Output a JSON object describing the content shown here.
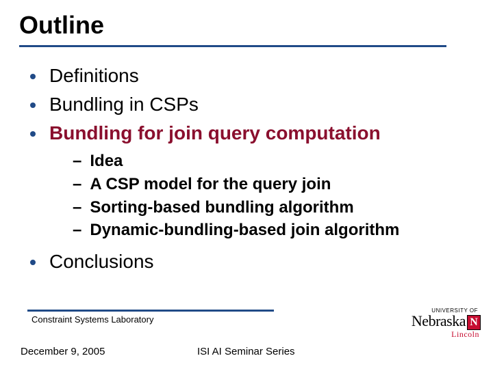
{
  "title": "Outline",
  "items": {
    "b1": "Definitions",
    "b2": "Bundling in CSPs",
    "b3": "Bundling for join query computation",
    "b3_subs": {
      "s1": "Idea",
      "s2": "A CSP model for the query join",
      "s3": "Sorting-based bundling algorithm",
      "s4": "Dynamic-bundling-based join algorithm"
    },
    "b4": "Conclusions"
  },
  "footer": {
    "lab": "Constraint Systems Laboratory",
    "date": "December 9, 2005",
    "series": "ISI AI Seminar Series"
  },
  "logo": {
    "univ": "UNIVERSITY OF",
    "name": "Nebraska",
    "mark": "N",
    "city": "Lincoln"
  }
}
